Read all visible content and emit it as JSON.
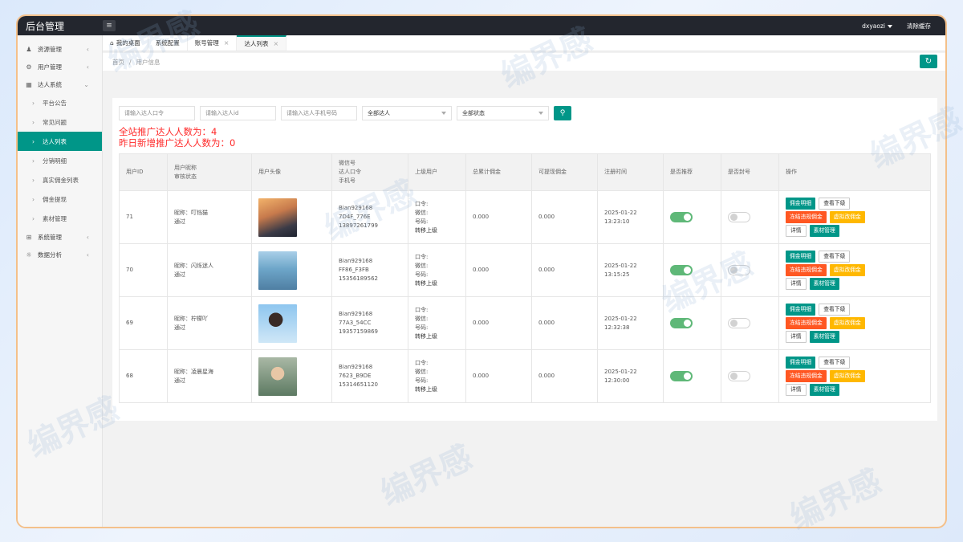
{
  "header": {
    "brand": "后台管理",
    "user": "dxyaozi",
    "clear_cache": "清除缓存"
  },
  "sidebar": {
    "items": [
      {
        "label": "资源管理",
        "icon": "user-icon",
        "arrow": "‹"
      },
      {
        "label": "用户管理",
        "icon": "settings-icon",
        "arrow": "‹"
      },
      {
        "label": "达人系统",
        "icon": "grid-icon",
        "arrow": "⌄"
      }
    ],
    "subitems": [
      "平台公告",
      "常见问题",
      "达人列表",
      "分销明细",
      "真实佣金列表",
      "佣金提现",
      "素材管理"
    ],
    "items_after": [
      {
        "label": "系统管理",
        "icon": "apps-icon",
        "arrow": "‹"
      },
      {
        "label": "数据分析",
        "icon": "gear-icon",
        "arrow": "‹"
      }
    ]
  },
  "tabs": [
    {
      "label": "我的桌面",
      "icon": "home-icon"
    },
    {
      "label": "系统配置"
    },
    {
      "label": "账号管理",
      "close": "×"
    },
    {
      "label": "达人列表",
      "close": "×"
    }
  ],
  "breadcrumb": {
    "home": "首页",
    "sep": "/",
    "current": "用户信息"
  },
  "filters": {
    "code_placeholder": "请输入达人口令",
    "id_placeholder": "请输入达人id",
    "phone_placeholder": "请输入达人手机号码",
    "type_select": "全部达人",
    "status_select": "全部状态"
  },
  "stats": {
    "total": "全站推广达人人数为：4",
    "yesterday": "昨日新增推广达人人数为：0"
  },
  "table": {
    "headers": {
      "id": "用户ID",
      "nick": [
        "用户昵称",
        "审核状态"
      ],
      "avatar": "用户头像",
      "contact": [
        "微信号",
        "达人口令",
        "手机号"
      ],
      "parent": "上级用户",
      "total": "总累计佣金",
      "withdrawable": "可提现佣金",
      "regtime": "注册时间",
      "recommend": "是否推荐",
      "ban": "是否封号",
      "ops": "操作"
    },
    "parent_labels": [
      "口令:",
      "微信:",
      "号码:",
      "转移上级"
    ],
    "ops_labels": [
      "佣金明细",
      "查看下级",
      "冻结违规佣金",
      "虚拟改佣金",
      "详情",
      "素材管理"
    ],
    "rows": [
      {
        "id": "71",
        "nick": "昵称：叮铛猫",
        "status": "通过",
        "wechat": "Bian929168",
        "code": "7D4F_776E",
        "phone": "13897261799",
        "total": "0.000",
        "withdrawable": "0.000",
        "date": "2025-01-22",
        "time": "13:23:10",
        "recommend": true,
        "banned": false,
        "avatar_style": "sunset"
      },
      {
        "id": "70",
        "nick": "昵称：闪烁迷人",
        "status": "通过",
        "wechat": "Bian929168",
        "code": "FF86_F3FB",
        "phone": "15356189562",
        "total": "0.000",
        "withdrawable": "0.000",
        "date": "2025-01-22",
        "time": "13:15:25",
        "recommend": true,
        "banned": false,
        "avatar_style": "sea"
      },
      {
        "id": "69",
        "nick": "昵称：柠檬吖",
        "status": "通过",
        "wechat": "Bian929168",
        "code": "77A3_54CC",
        "phone": "19357159869",
        "total": "0.000",
        "withdrawable": "0.000",
        "date": "2025-01-22",
        "time": "12:32:38",
        "recommend": true,
        "banned": false,
        "avatar_style": "sky"
      },
      {
        "id": "68",
        "nick": "昵称：凌晨星海",
        "status": "通过",
        "wechat": "Bian929168",
        "code": "7623_B9DE",
        "phone": "15314651120",
        "total": "0.000",
        "withdrawable": "0.000",
        "date": "2025-01-22",
        "time": "12:30:00",
        "recommend": true,
        "banned": false,
        "avatar_style": "green"
      }
    ]
  },
  "colors": {
    "accent": "#009688",
    "danger": "#ff5722",
    "warn": "#ffb800",
    "topbar": "#23262e",
    "stat": "#ff2a2a"
  }
}
